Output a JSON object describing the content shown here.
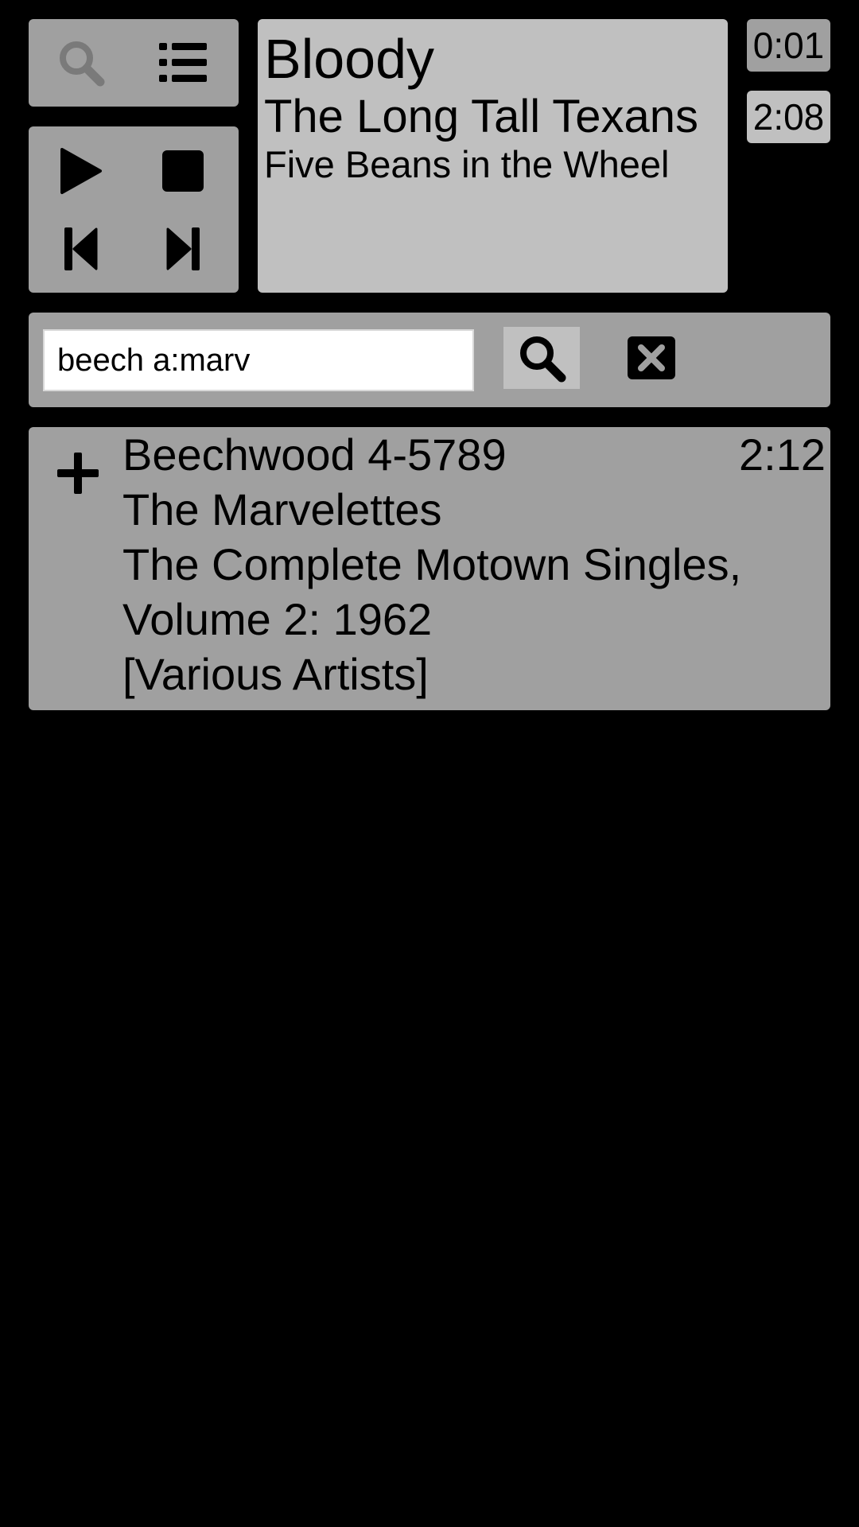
{
  "controls": {
    "search_view_icon": "search-icon",
    "playlist_view_icon": "list-icon",
    "play_icon": "play-icon",
    "stop_icon": "stop-icon",
    "prev_icon": "skip-previous-icon",
    "next_icon": "skip-next-icon"
  },
  "now_playing": {
    "title": "Bloody",
    "artist": "The Long Tall Texans",
    "album": "Five Beans in the Wheel",
    "elapsed": "0:01",
    "duration": "2:08"
  },
  "search": {
    "query": "beech a:marv",
    "submit_icon": "search-icon",
    "clear_icon": "close-box-icon"
  },
  "results": [
    {
      "title": "Beechwood 4-5789",
      "artist": "The Marvelettes",
      "album_lines": [
        "The Complete Motown Singles,",
        "Volume 2: 1962",
        "[Various Artists]"
      ],
      "duration": "2:12",
      "action_icon": "add-icon"
    }
  ],
  "colors": {
    "background": "#000000",
    "panel": "#a0a0a0",
    "panel_light": "#c0c0c0",
    "inactive_icon": "#7a7a7a",
    "active_icon": "#000000"
  }
}
